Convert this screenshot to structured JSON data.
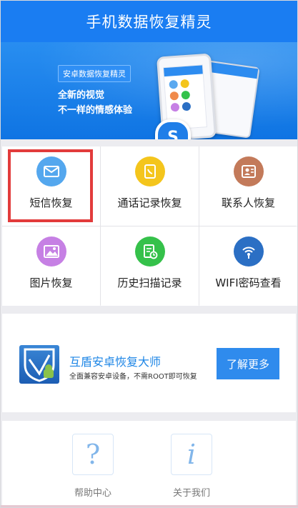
{
  "header": {
    "title": "手机数据恢复精灵"
  },
  "banner": {
    "tag": "安卓数据恢复精灵",
    "line1": "全新的视觉",
    "line2": "不一样的情感体验",
    "pager": {
      "count": 3,
      "active_index": 2
    }
  },
  "grid": {
    "items": [
      {
        "label": "短信恢复",
        "icon": "envelope-icon",
        "color": "#54a7ee"
      },
      {
        "label": "通话记录恢复",
        "icon": "phone-book-icon",
        "color": "#f4c51c"
      },
      {
        "label": "联系人恢复",
        "icon": "contact-card-icon",
        "color": "#c37a5a"
      },
      {
        "label": "图片恢复",
        "icon": "picture-icon",
        "color": "#c680e4"
      },
      {
        "label": "历史扫描记录",
        "icon": "clock-document-icon",
        "color": "#35c14a"
      },
      {
        "label": "WIFI密码查看",
        "icon": "wifi-icon",
        "color": "#2b6fc4"
      }
    ]
  },
  "promo": {
    "title": "互盾安卓恢复大师",
    "subtitle": "全面兼容安卓设备，不需ROOT即可恢复",
    "button": "了解更多"
  },
  "bottom": {
    "help": {
      "label": "帮助中心",
      "glyph": "?"
    },
    "about": {
      "label": "关于我们",
      "glyph": "i"
    }
  },
  "colors": {
    "primary": "#1a7df2",
    "highlight": "#e23b3b"
  }
}
